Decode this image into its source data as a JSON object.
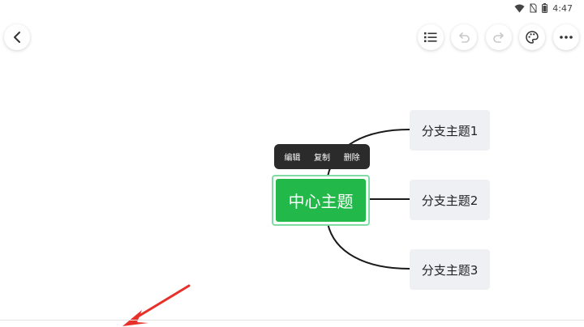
{
  "status_bar": {
    "time": "4:47"
  },
  "toolbar": {
    "back_icon": "chevron-left-icon",
    "outline_icon": "list-icon",
    "undo_icon": "undo-icon",
    "redo_icon": "redo-icon",
    "theme_icon": "palette-icon",
    "more_icon": "more-icon"
  },
  "mindmap": {
    "central_topic": "中心主题",
    "branches": [
      {
        "label": "分支主题1"
      },
      {
        "label": "分支主题2"
      },
      {
        "label": "分支主题3"
      }
    ],
    "line_color": "#1a1a1a",
    "central_color": "#22b94a"
  },
  "context_menu": {
    "items": [
      "编辑",
      "复制",
      "删除"
    ]
  },
  "annotation": {
    "arrow_color": "#e8302a"
  }
}
